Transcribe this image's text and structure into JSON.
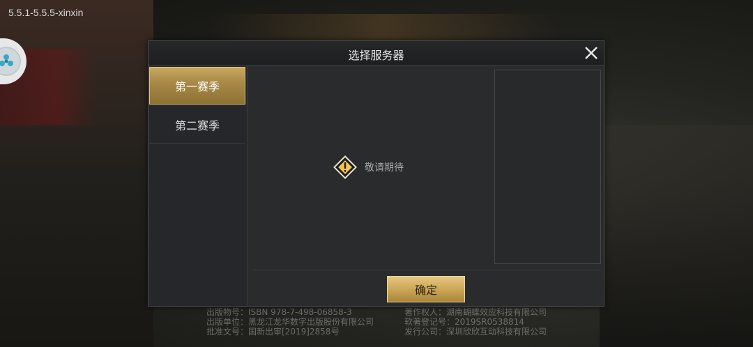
{
  "version": "5.5.1-5.5.5-xinxin",
  "dialog": {
    "title": "选择服务器",
    "tabs": [
      {
        "label": "第一赛季",
        "active": true
      },
      {
        "label": "第二赛季",
        "active": false
      }
    ],
    "notice": "敬请期待",
    "confirm_label": "确定"
  },
  "copyright": {
    "left": [
      "出版物号：ISBN 978-7-498-06858-3",
      "出版单位：黑龙江龙华数字出版股份有限公司",
      "批准文号：国新出审[2019]2858号"
    ],
    "right": [
      "著作权人：湖南蝴蝶效应科技有限公司",
      "软著登记号：2019SR0538814",
      "发行公司：深圳欣欣互动科技有限公司"
    ]
  },
  "colors": {
    "accent_gold": "#c9a455",
    "dialog_bg": "#2a2b2d"
  },
  "icons": {
    "close": "close-icon",
    "warning": "warning-icon",
    "float_ball": "assistive-ball-icon"
  }
}
